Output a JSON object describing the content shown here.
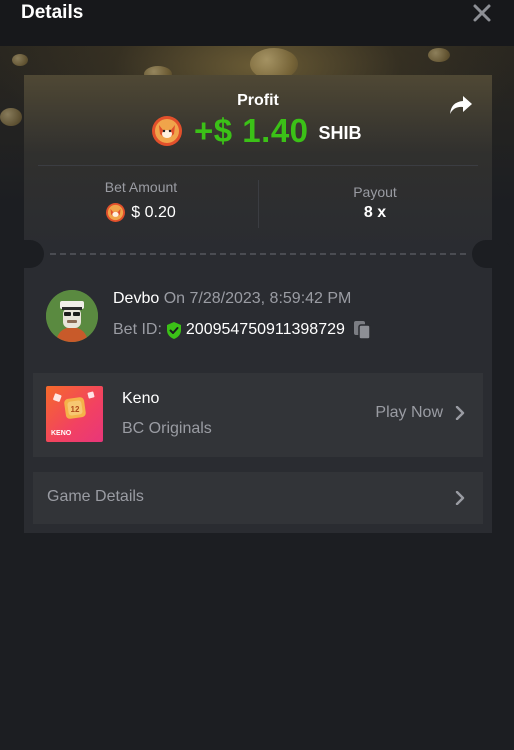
{
  "header": {
    "title": "Details"
  },
  "icons": {
    "close": "close-icon",
    "share": "share-icon",
    "coin": "shib-coin-icon",
    "verified": "shield-check-icon",
    "copy": "copy-icon",
    "chevron": "chevron-right-icon"
  },
  "colors": {
    "profit": "#3bc117",
    "verified": "#3bc117",
    "background": "#1c1e22",
    "card": "#2a2c31"
  },
  "profit": {
    "label": "Profit",
    "amount": "+$ 1.40",
    "currency": "SHIB"
  },
  "stats": {
    "bet_amount_label": "Bet Amount",
    "bet_amount_value": "$ 0.20",
    "payout_label": "Payout",
    "payout_value": "8 x"
  },
  "user": {
    "name": "Devbo",
    "on_text": " On 7/28/2023, 8:59:42 PM",
    "bet_id_label": "Bet ID:",
    "bet_id": "200954750911398729"
  },
  "game": {
    "name": "Keno",
    "provider": "BC Originals",
    "play_label": "Play Now",
    "thumb_text": "KENO",
    "thumb_number": "12"
  },
  "game_details": {
    "label": "Game Details"
  }
}
